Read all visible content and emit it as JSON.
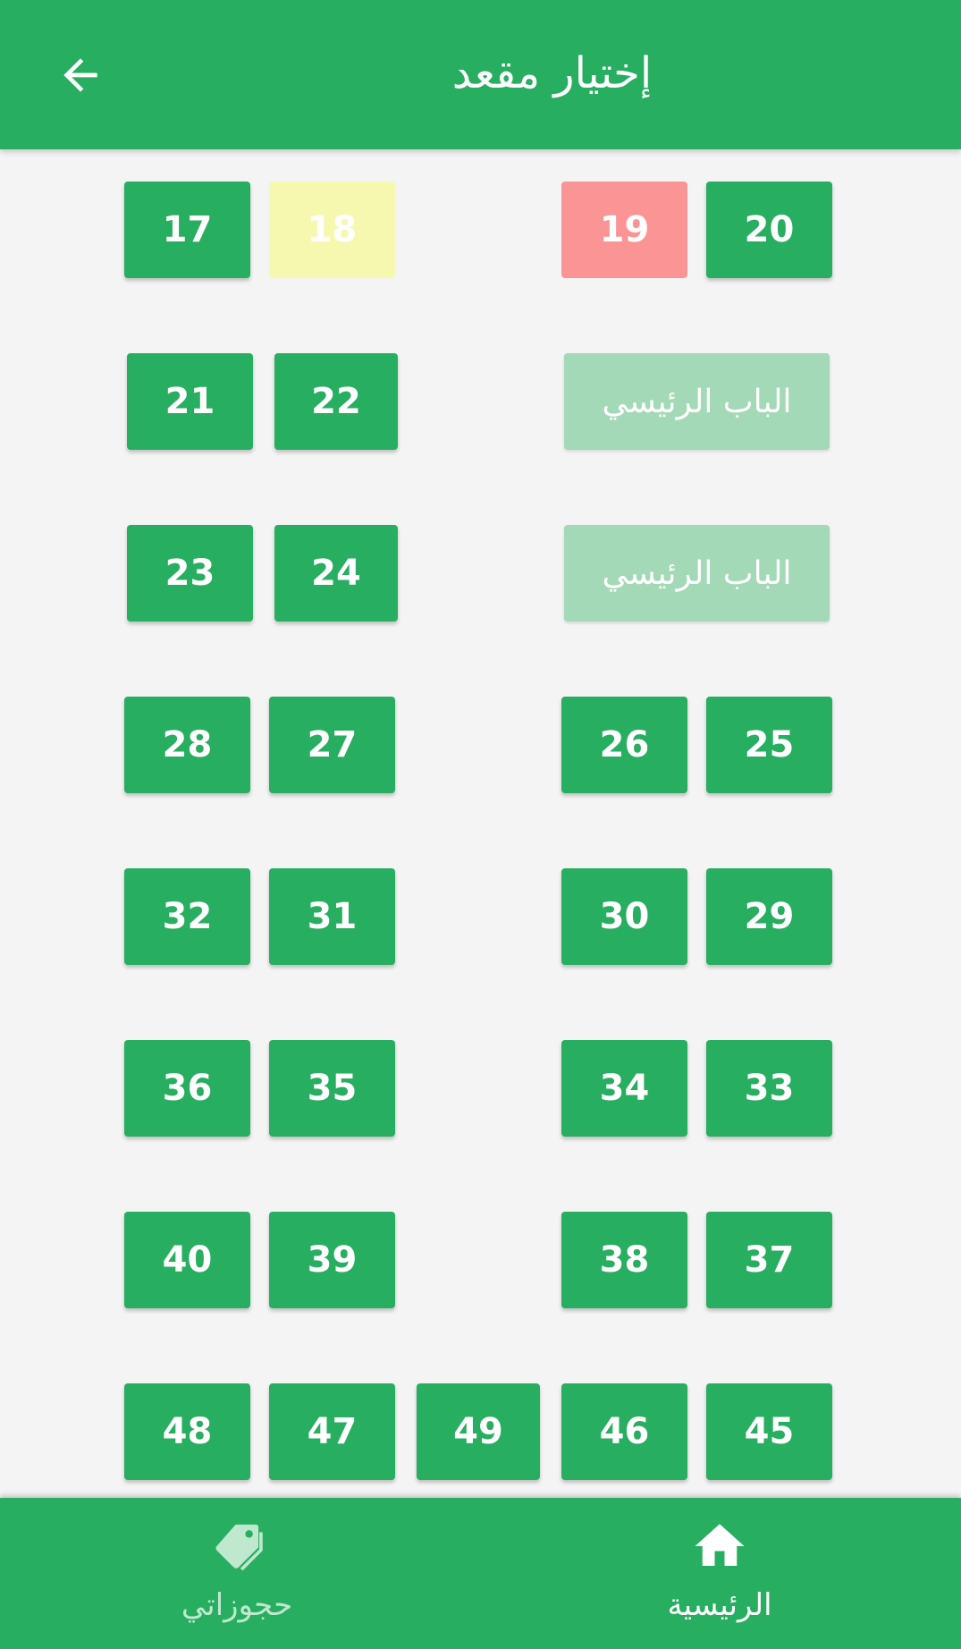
{
  "header": {
    "title": "إختيار مقعد"
  },
  "seats": {
    "s17": "17",
    "s18": "18",
    "s19": "19",
    "s20": "20",
    "s21": "21",
    "s22": "22",
    "s23": "23",
    "s24": "24",
    "s25": "25",
    "s26": "26",
    "s27": "27",
    "s28": "28",
    "s29": "29",
    "s30": "30",
    "s31": "31",
    "s32": "32",
    "s33": "33",
    "s34": "34",
    "s35": "35",
    "s36": "36",
    "s37": "37",
    "s38": "38",
    "s39": "39",
    "s40": "40",
    "s45": "45",
    "s46": "46",
    "s47": "47",
    "s48": "48",
    "s49": "49"
  },
  "door_label": "الباب الرئيسي",
  "colors": {
    "primary": "#28ae60",
    "selected": "#f7f8b0",
    "booked": "#fb9595",
    "door": "#a4d9b7"
  },
  "bottom_nav": {
    "home": {
      "label": "الرئيسية",
      "icon": "home-icon"
    },
    "bookings": {
      "label": "حجوزاتي",
      "icon": "tag-icon"
    }
  }
}
